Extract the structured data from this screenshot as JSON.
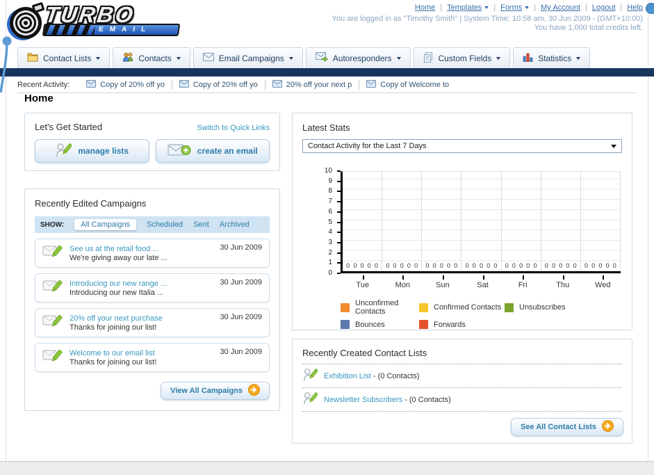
{
  "brand": {
    "top": "TURBO",
    "bottom": "EMAIL"
  },
  "header": {
    "links": [
      {
        "label": "Home"
      },
      {
        "label": "Templates"
      },
      {
        "label": "Forms"
      },
      {
        "label": "My Account"
      },
      {
        "label": "Logout"
      },
      {
        "label": "Help"
      }
    ],
    "login_line": "You are logged in as \"Timothy Smith\" | System Time: 10:58 am, 30 Jun 2009 - (GMT+10:00)",
    "credits_line": "You have 1,000 total credits left."
  },
  "nav": {
    "tabs": [
      {
        "label": "Contact Lists"
      },
      {
        "label": "Contacts"
      },
      {
        "label": "Email Campaigns"
      },
      {
        "label": "Autoresponders"
      },
      {
        "label": "Custom Fields"
      },
      {
        "label": "Statistics"
      }
    ]
  },
  "recent_activity": {
    "label": "Recent Activity:",
    "items": [
      "Copy of 20% off yo",
      "Copy of 20% off yo",
      "20% off your next p",
      "Copy of Welcome to"
    ]
  },
  "page": {
    "title": "Home"
  },
  "get_started": {
    "title": "Let's Get Started",
    "switch_link": "Switch to Quick Links",
    "manage_button": "manage lists",
    "create_button": "create an email"
  },
  "campaigns": {
    "title": "Recently Edited Campaigns",
    "show_label": "SHOW:",
    "filters": [
      "All Campaigns",
      "Scheduled",
      "Sent",
      "Archived"
    ],
    "active_filter": "All Campaigns",
    "items": [
      {
        "title": "See us at the retail food ...",
        "subtitle": "We're giving away our late ...",
        "date": "30 Jun 2009"
      },
      {
        "title": "Introducing our new range ...",
        "subtitle": "Introducing our new Italia ...",
        "date": "30 Jun 2009"
      },
      {
        "title": "20% off your next purchase",
        "subtitle": "Thanks for joining our list!",
        "date": "30 Jun 2009"
      },
      {
        "title": "Welcome to our email list",
        "subtitle": "Thanks for joining our list!",
        "date": "30 Jun 2009"
      }
    ],
    "view_all": "View All Campaigns"
  },
  "stats": {
    "title": "Latest Stats",
    "dropdown_value": "Contact Activity for the Last 7 Days"
  },
  "chart_data": {
    "type": "bar",
    "title": "Contact Activity for the Last 7 Days",
    "categories": [
      "Tue",
      "Mon",
      "Sun",
      "Sat",
      "Fri",
      "Thu",
      "Wed"
    ],
    "series": [
      {
        "name": "Unconfirmed Contacts",
        "color": "#f28c2d",
        "values": [
          0,
          0,
          0,
          0,
          0,
          0,
          0
        ]
      },
      {
        "name": "Confirmed Contacts",
        "color": "#f6c62f",
        "values": [
          0,
          0,
          0,
          0,
          0,
          0,
          0
        ]
      },
      {
        "name": "Unsubscribes",
        "color": "#7ba32d",
        "values": [
          0,
          0,
          0,
          0,
          0,
          0,
          0
        ]
      },
      {
        "name": "Bounces",
        "color": "#5b79ac",
        "values": [
          0,
          0,
          0,
          0,
          0,
          0,
          0
        ]
      },
      {
        "name": "Forwards",
        "color": "#e2512b",
        "values": [
          0,
          0,
          0,
          0,
          0,
          0,
          0
        ]
      }
    ],
    "xlabel": "",
    "ylabel": "",
    "ylim": [
      0,
      10
    ],
    "yticks": [
      0,
      1,
      2,
      3,
      4,
      5,
      6,
      7,
      8,
      9,
      10
    ],
    "grid": true,
    "legend_position": "bottom",
    "value_labels_shown": true
  },
  "contact_lists": {
    "title": "Recently Created Contact Lists",
    "items": [
      {
        "name": "Exhibition List",
        "suffix": " - (0 Contacts)"
      },
      {
        "name": "Newsletter Subscribers",
        "suffix": " - (0 Contacts)"
      }
    ],
    "see_all": "See All Contact Lists"
  }
}
